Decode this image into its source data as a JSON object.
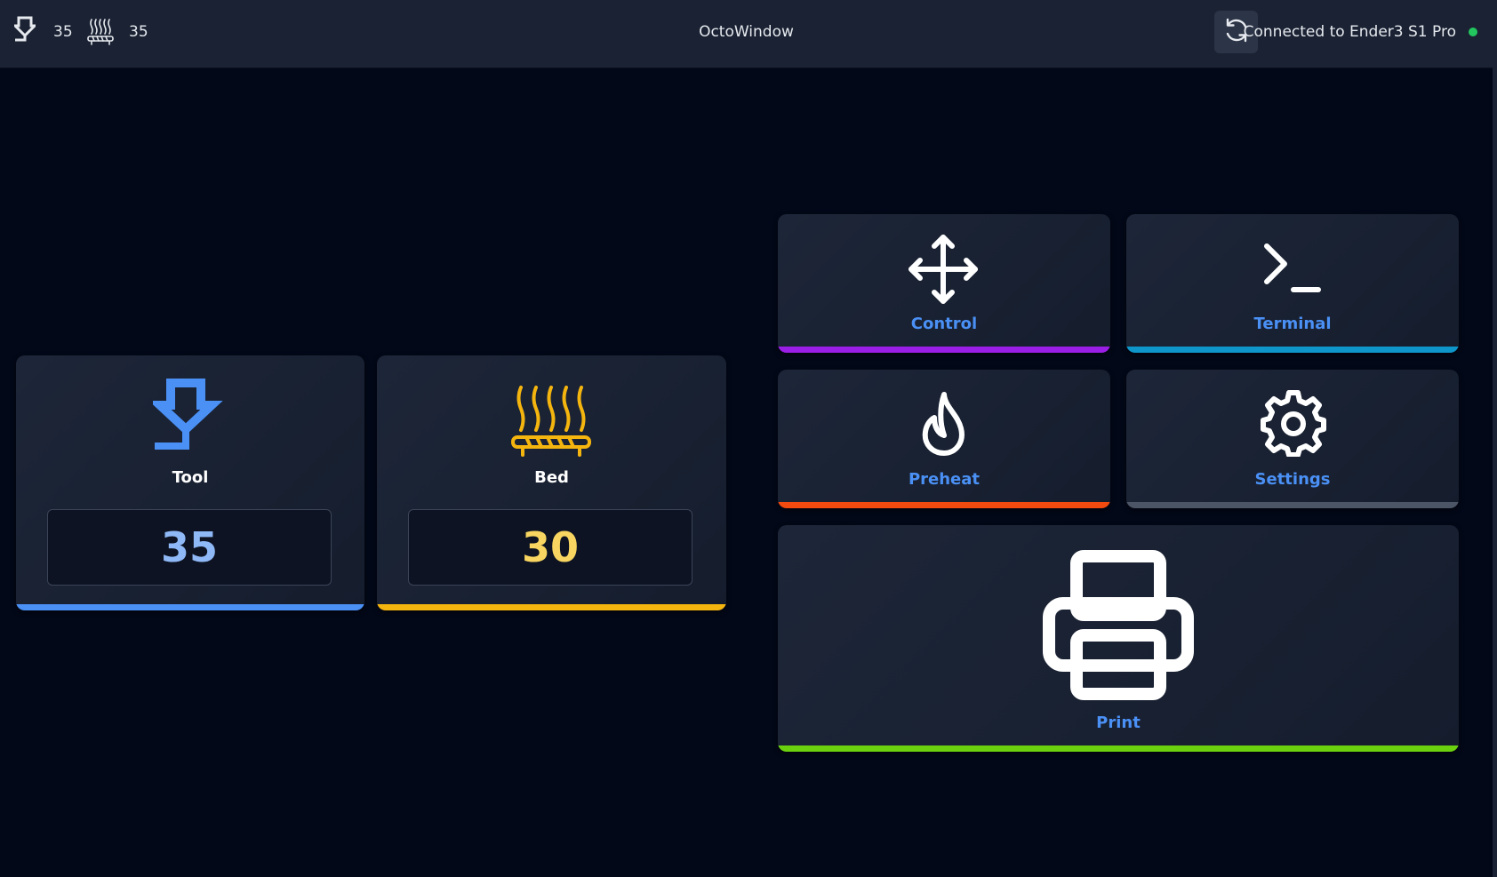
{
  "topbar": {
    "tool_icon": "extruder-nozzle-icon",
    "tool_temp": "35",
    "bed_icon": "heated-bed-icon",
    "bed_temp": "35",
    "title": "OctoWindow",
    "refresh_icon": "refresh-icon",
    "connection_text": "Connected to Ender3 S1 Pro",
    "connection_status_color": "#22c55e"
  },
  "temperatures": {
    "tool": {
      "label": "Tool",
      "value": "35",
      "icon": "extruder-nozzle-icon",
      "color": "#4a90f5",
      "value_color": "#8fb8f7"
    },
    "bed": {
      "label": "Bed",
      "value": "30",
      "icon": "heated-bed-icon",
      "color": "#f5b50f",
      "value_color": "#f7d560"
    }
  },
  "actions": {
    "control": {
      "label": "Control",
      "icon": "move-arrows-icon",
      "accent": "#9b1ee6"
    },
    "terminal": {
      "label": "Terminal",
      "icon": "terminal-prompt-icon",
      "accent": "#0e95c9"
    },
    "preheat": {
      "label": "Preheat",
      "icon": "flame-icon",
      "accent": "#f24a0f"
    },
    "settings": {
      "label": "Settings",
      "icon": "gear-icon",
      "accent": "#4b5565"
    },
    "print": {
      "label": "Print",
      "icon": "printer-icon",
      "accent": "#6bd10f"
    }
  },
  "label_color": "#4a90f5"
}
